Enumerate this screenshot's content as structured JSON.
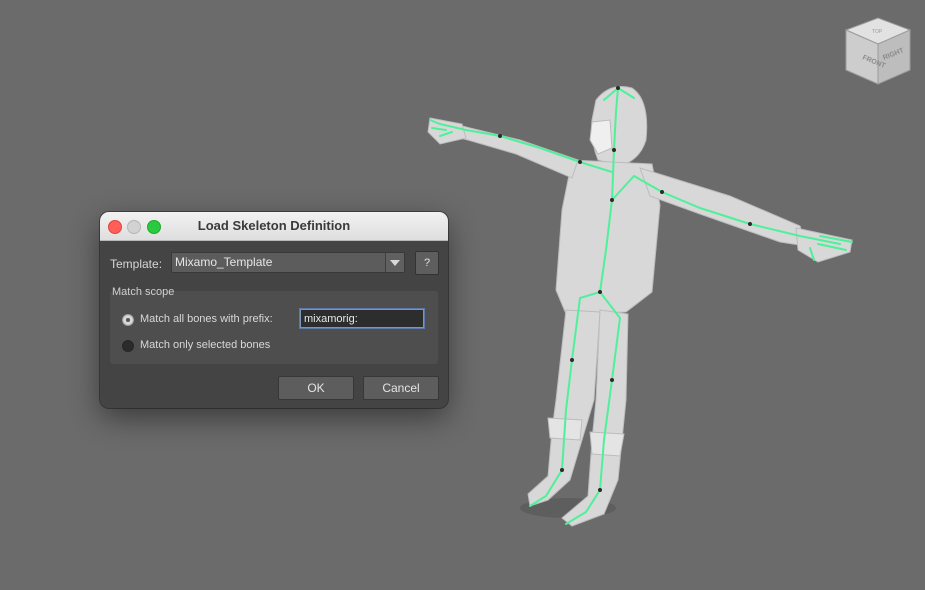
{
  "viewcube": {
    "face_front": "FRONT",
    "face_right": "RIGHT",
    "face_top": "TOP"
  },
  "dialog": {
    "title": "Load Skeleton Definition",
    "template_label": "Template:",
    "template_value": "Mixamo_Template",
    "help_label": "?",
    "match_scope": {
      "title": "Match scope",
      "option_prefix_label": "Match all bones with prefix:",
      "option_prefix_selected": true,
      "prefix_value": "mixamorig:",
      "option_selected_label": "Match only selected bones",
      "option_selected_selected": false
    },
    "ok_label": "OK",
    "cancel_label": "Cancel"
  },
  "colors": {
    "viewport_bg": "#6b6b6b",
    "skeleton": "#4ff09a",
    "mesh": "#d9d9d9",
    "close": "#ff5f57",
    "minimize": "#d2d2d2",
    "maximize": "#29c940"
  }
}
